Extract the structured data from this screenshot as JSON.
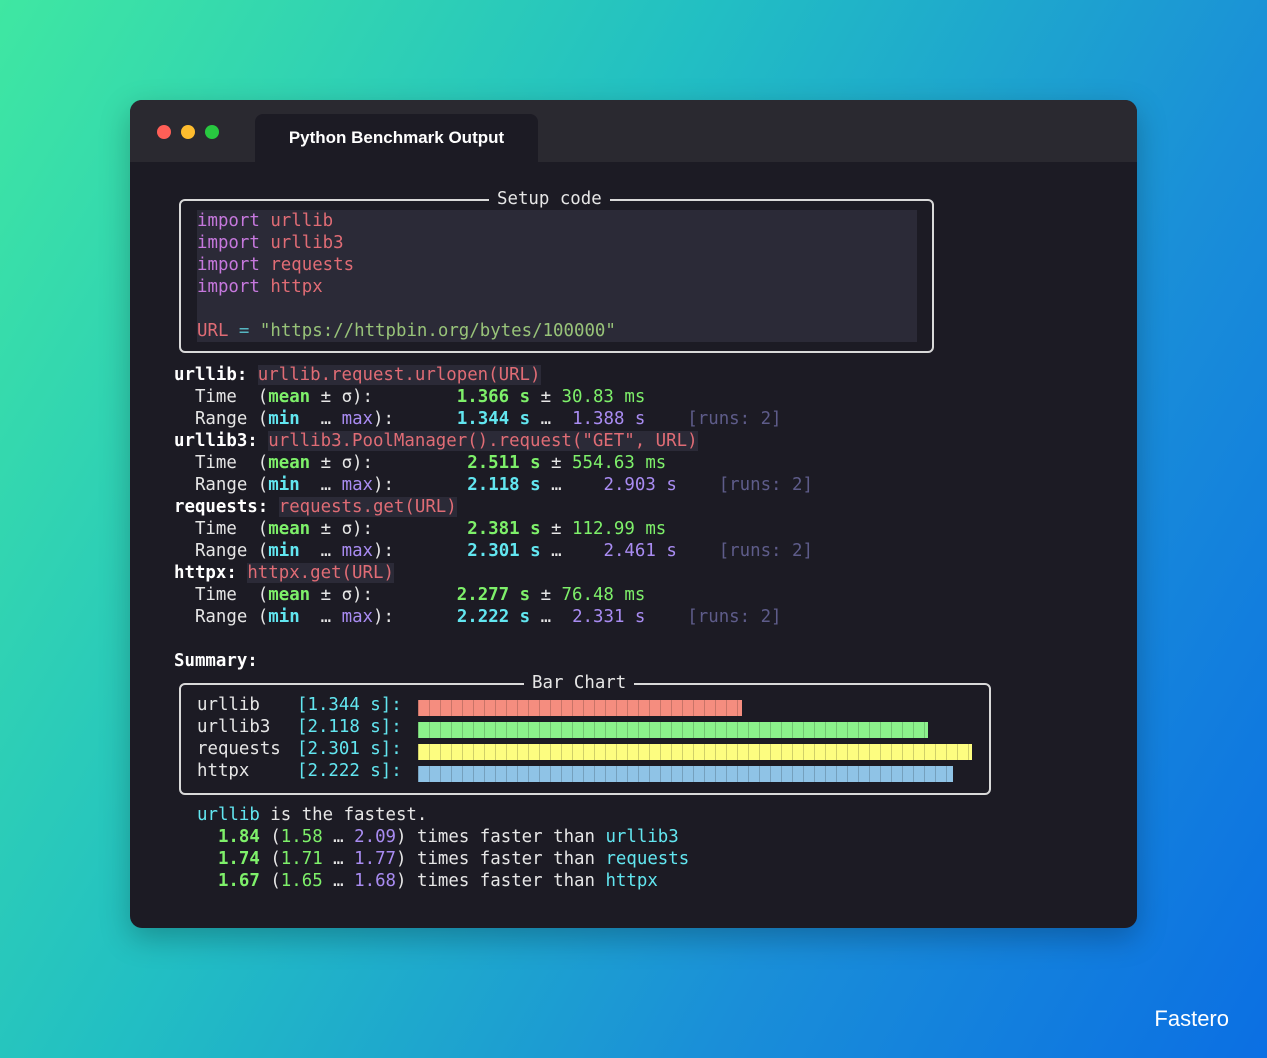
{
  "window": {
    "title": "Python Benchmark Output"
  },
  "setup": {
    "title": "Setup code",
    "imports": [
      {
        "kw": "import",
        "mod": "urllib"
      },
      {
        "kw": "import",
        "mod": "urllib3"
      },
      {
        "kw": "import",
        "mod": "requests"
      },
      {
        "kw": "import",
        "mod": "httpx"
      }
    ],
    "url_var": "URL",
    "url_op": "=",
    "url_value": "\"https://httpbin.org/bytes/100000\""
  },
  "labels": {
    "time": "Time",
    "mean": "mean",
    "pm_sigma": "± σ):",
    "range": "Range",
    "min": "min",
    "ellipsis_max": "…",
    "max": "max",
    "close_colon": "):",
    "pm": "±",
    "s_unit": "s",
    "ms_unit": "ms",
    "ell": "…"
  },
  "benchmarks": [
    {
      "name": "urllib",
      "cmd": "urllib.request.urlopen(URL)",
      "mean": "1.366",
      "sigma": "30.83",
      "min": "1.344",
      "max": "1.388",
      "runs": "[runs: 2]"
    },
    {
      "name": "urllib3",
      "cmd": "urllib3.PoolManager().request(\"GET\", URL)",
      "mean": "2.511",
      "sigma": "554.63",
      "min": "2.118",
      "max": "2.903",
      "runs": "[runs: 2]"
    },
    {
      "name": "requests",
      "cmd": "requests.get(URL)",
      "mean": "2.381",
      "sigma": "112.99",
      "min": "2.301",
      "max": "2.461",
      "runs": "[runs: 2]"
    },
    {
      "name": "httpx",
      "cmd": "httpx.get(URL)",
      "mean": "2.277",
      "sigma": "76.48",
      "min": "2.222",
      "max": "2.331",
      "runs": "[runs: 2]"
    }
  ],
  "summary": {
    "title": "Summary:",
    "chart_title": "Bar Chart",
    "fastest_name": "urllib",
    "fastest_text": " is the fastest.",
    "comparisons": [
      {
        "factor": "1.84",
        "lo": "1.58",
        "hi": "2.09",
        "text": " times faster than ",
        "target": "urllib3"
      },
      {
        "factor": "1.74",
        "lo": "1.71",
        "hi": "1.77",
        "text": " times faster than ",
        "target": "requests"
      },
      {
        "factor": "1.67",
        "lo": "1.65",
        "hi": "1.68",
        "text": " times faster than ",
        "target": "httpx"
      }
    ]
  },
  "chart_data": {
    "type": "bar",
    "title": "Bar Chart",
    "categories": [
      "urllib",
      "urllib3",
      "requests",
      "httpx"
    ],
    "value_labels": [
      "[1.344 s]:",
      "[2.118 s]:",
      "[2.301 s]:",
      "[2.222 s]:"
    ],
    "values": [
      1.344,
      2.118,
      2.301,
      2.222
    ],
    "colors": [
      "#f58d7f",
      "#8cf28c",
      "#fdfd80",
      "#8fc3e6"
    ],
    "xlim": [
      0,
      2.301
    ]
  },
  "watermark": "Fastero"
}
